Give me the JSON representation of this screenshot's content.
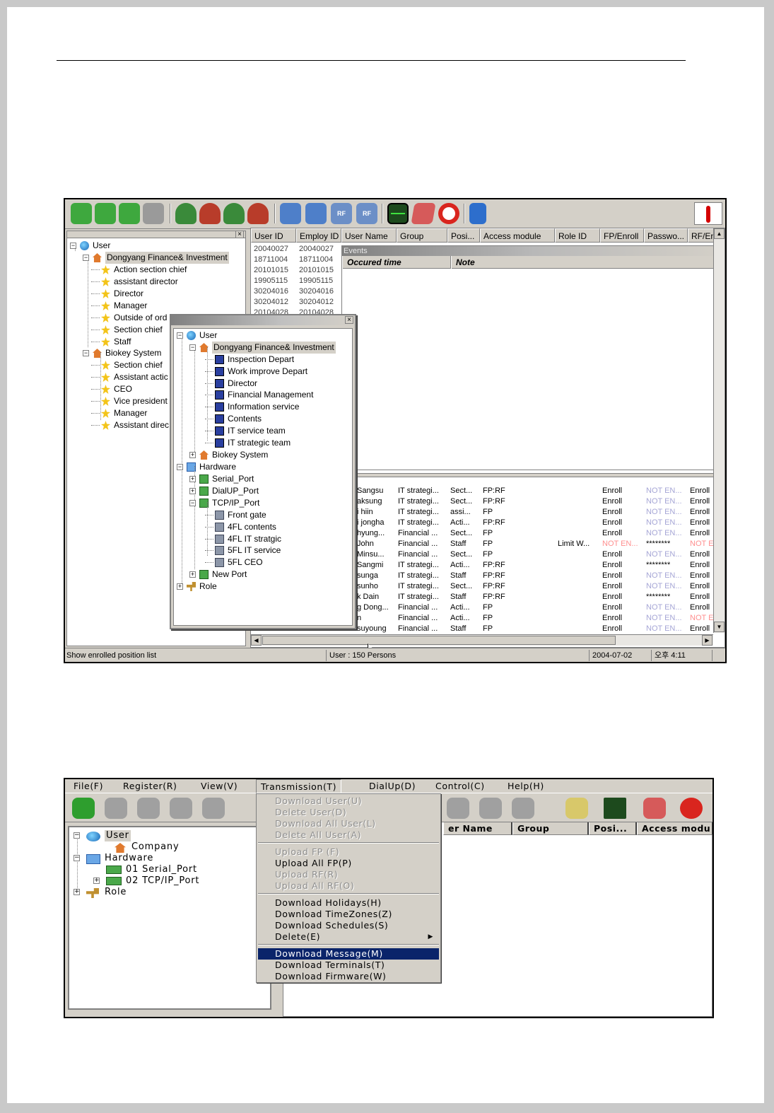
{
  "screen1": {
    "left_tree": {
      "root": "User",
      "company1": "Dongyang Finance& Investment",
      "company1_items": [
        "Action section chief",
        "assistant director",
        "Director",
        "Manager",
        "Outside of ord",
        "Section chief",
        "Staff"
      ],
      "company2": "Biokey System",
      "company2_items": [
        "Section chief",
        "Assistant actic",
        "CEO",
        "Vice president",
        "Manager",
        "Assistant direc"
      ]
    },
    "grid": {
      "headers": [
        "User ID",
        "Employ ID",
        "User Name",
        "Group",
        "Posi...",
        "Access module",
        "Role ID",
        "FP/Enroll",
        "Passwo...",
        "RF/En"
      ],
      "top_rows": [
        [
          "20040027",
          "20040027"
        ],
        [
          "18711004",
          "18711004"
        ],
        [
          "20101015",
          "20101015"
        ],
        [
          "19905115",
          "19905115"
        ],
        [
          "30204016",
          "30204016"
        ],
        [
          "30204012",
          "30204012"
        ],
        [
          "20104028",
          "20104028"
        ]
      ],
      "bottom_rows": [
        {
          "name": "Sangsu",
          "group": "IT strategi...",
          "pos": "Sect...",
          "access": "FP:RF",
          "role": "",
          "fp": "Enroll",
          "pw": "NOT EN...",
          "rf": "Enroll"
        },
        {
          "name": "aksung",
          "group": "IT strategi...",
          "pos": "Sect...",
          "access": "FP:RF",
          "role": "",
          "fp": "Enroll",
          "pw": "NOT EN...",
          "rf": "Enroll"
        },
        {
          "name": "i hiin",
          "group": "IT strategi...",
          "pos": "assi...",
          "access": "FP",
          "role": "",
          "fp": "Enroll",
          "pw": "NOT EN...",
          "rf": "Enroll"
        },
        {
          "name": "i jongha",
          "group": "IT strategi...",
          "pos": "Acti...",
          "access": "FP:RF",
          "role": "",
          "fp": "Enroll",
          "pw": "NOT EN...",
          "rf": "Enroll"
        },
        {
          "name": "hyung...",
          "group": "Financial ...",
          "pos": "Sect...",
          "access": "FP",
          "role": "",
          "fp": "Enroll",
          "pw": "NOT EN...",
          "rf": "Enroll"
        },
        {
          "name": "John",
          "group": "Financial ...",
          "pos": "Staff",
          "access": "FP",
          "role": "Limit W...",
          "fp": "NOT EN...",
          "pw": "********",
          "rf": "NOT E"
        },
        {
          "name": "Minsu...",
          "group": "Financial ...",
          "pos": "Sect...",
          "access": "FP",
          "role": "",
          "fp": "Enroll",
          "pw": "NOT EN...",
          "rf": "Enroll"
        },
        {
          "name": "Sangmi",
          "group": "IT strategi...",
          "pos": "Acti...",
          "access": "FP:RF",
          "role": "",
          "fp": "Enroll",
          "pw": "********",
          "rf": "Enroll"
        },
        {
          "name": "sunga",
          "group": "IT strategi...",
          "pos": "Staff",
          "access": "FP:RF",
          "role": "",
          "fp": "Enroll",
          "pw": "NOT EN...",
          "rf": "Enroll"
        },
        {
          "name": "sunho",
          "group": "IT strategi...",
          "pos": "Sect...",
          "access": "FP:RF",
          "role": "",
          "fp": "Enroll",
          "pw": "NOT EN...",
          "rf": "Enroll"
        },
        {
          "name": "k Dain",
          "group": "IT strategi...",
          "pos": "Staff",
          "access": "FP:RF",
          "role": "",
          "fp": "Enroll",
          "pw": "********",
          "rf": "Enroll"
        },
        {
          "name": "g Dong...",
          "group": "Financial ...",
          "pos": "Acti...",
          "access": "FP",
          "role": "",
          "fp": "Enroll",
          "pw": "NOT EN...",
          "rf": "Enroll"
        },
        {
          "name": "n",
          "group": "Financial ...",
          "pos": "Acti...",
          "access": "FP",
          "role": "",
          "fp": "Enroll",
          "pw": "NOT EN...",
          "rf": "NOT E"
        },
        {
          "name": "suyoung",
          "group": "Financial ...",
          "pos": "Staff",
          "access": "FP",
          "role": "",
          "fp": "Enroll",
          "pw": "NOT EN...",
          "rf": "Enroll"
        }
      ]
    },
    "events": {
      "title": "Events",
      "col_time": "Occured time",
      "col_note": "Note"
    },
    "popup_tree": {
      "root": "User",
      "company1": "Dongyang Finance& Investment",
      "departments": [
        "Inspection Depart",
        "Work improve Depart",
        "Director",
        "Financial Management",
        "Information service",
        "Contents",
        "IT service team",
        "IT strategic team"
      ],
      "company2": "Biokey System",
      "hardware": "Hardware",
      "ports": [
        "Serial_Port",
        "DialUP_Port",
        "TCP/IP_Port"
      ],
      "terminals": [
        "Front gate",
        "4FL contents",
        "4FL IT stratgic",
        "5FL IT service",
        "5FL CEO"
      ],
      "new_port": "New Port",
      "role": "Role"
    },
    "status": {
      "left": "Show enrolled position list",
      "user_count": "User : 150 Persons",
      "date": "2004-07-02",
      "time": "오후 4:11"
    }
  },
  "screen2": {
    "menubar": [
      "File(F)",
      "Register(R)",
      "View(V)",
      "Transmission(T)",
      "DialUp(D)",
      "Control(C)",
      "Help(H)"
    ],
    "tree": {
      "user": "User",
      "company": "Company",
      "hardware": "Hardware",
      "port1": "01 Serial_Port",
      "port2": "02 TCP/IP_Port",
      "role": "Role"
    },
    "grid_headers": [
      "er Name",
      "Group",
      "Posi...",
      "Access modu"
    ],
    "menu_items": [
      {
        "label": "Download User(U)",
        "state": "disabled"
      },
      {
        "label": "Delete User(D)",
        "state": "disabled"
      },
      {
        "label": "Download All User(L)",
        "state": "disabled"
      },
      {
        "label": "Delete All User(A)",
        "state": "disabled"
      },
      {
        "label": "Upload FP (F)",
        "state": "disabled"
      },
      {
        "label": "Upload All FP(P)",
        "state": "enabled"
      },
      {
        "label": "Upload RF(R)",
        "state": "disabled"
      },
      {
        "label": "Upload All RF(O)",
        "state": "disabled"
      },
      {
        "label": "Download Holidays(H)",
        "state": "enabled"
      },
      {
        "label": "Download TimeZones(Z)",
        "state": "enabled"
      },
      {
        "label": "Download Schedules(S)",
        "state": "enabled"
      },
      {
        "label": "Delete(E)",
        "state": "submenu"
      },
      {
        "label": "Download Message(M)",
        "state": "active"
      },
      {
        "label": "Download Terminals(T)",
        "state": "enabled"
      },
      {
        "label": "Download Firmware(W)",
        "state": "enabled"
      }
    ]
  }
}
